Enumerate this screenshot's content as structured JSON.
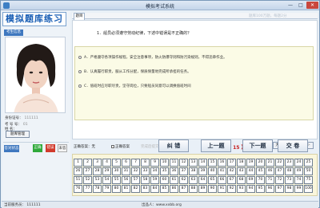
{
  "window": {
    "title": "模拟考试系统",
    "min": "—",
    "max": "□",
    "close": "✕"
  },
  "left": {
    "brand": "模拟题库练习",
    "photo_label": "考生信息",
    "id_card_label": "身份证号：",
    "id_card_value": "111111",
    "exam_no_label": "考 号 号：",
    "exam_no_value": "01",
    "name_label": "姓  名：",
    "name_value": "",
    "exam_manage_button": "题库管理",
    "status_label": "答对状态",
    "chip_correct": "正确",
    "chip_wrong": "错误",
    "chip_unanswered": "未答"
  },
  "tabs": {
    "active": "题目"
  },
  "watermark": "题库100万题，每题2分",
  "question": {
    "text": "1．船员必须遵守劳动纪律，下述中错误是不正确的？",
    "options": [
      "A．严格遵守各项操作规程，安全注意事项，防火防爆守则和防污染规则，不得违章作业。",
      "B．认真履行职责，服从工作分配，保质保量地完成所承担的任务。",
      "C．值班时应尽职尽责，坚守岗位，只要船员同意可以调换值班时间"
    ]
  },
  "answer": {
    "label": "正确答案：",
    "value": "无",
    "check_label": "正确答案",
    "hint": "完成后提交本题",
    "number_label": "题库编号：【 15 】",
    "font_big": "大字体+",
    "font_small": "小字体-"
  },
  "nav": {
    "correct": "纠 错",
    "prev": "上一题",
    "next": "下一题",
    "submit": "交 卷"
  },
  "grid": {
    "rows": [
      [
        "1",
        "2",
        "3",
        "4",
        "5",
        "6",
        "7",
        "8",
        "9",
        "10",
        "11",
        "12",
        "13",
        "14",
        "15",
        "16",
        "17",
        "18",
        "19",
        "20",
        "21",
        "22",
        "23",
        "24",
        "25"
      ],
      [
        "26",
        "27",
        "28",
        "29",
        "30",
        "31",
        "32",
        "33",
        "34",
        "35",
        "36",
        "37",
        "38",
        "39",
        "40",
        "41",
        "42",
        "43",
        "44",
        "45",
        "46",
        "47",
        "48",
        "49",
        "50"
      ],
      [
        "51",
        "52",
        "53",
        "54",
        "55",
        "56",
        "57",
        "58",
        "59",
        "60",
        "61",
        "62",
        "63",
        "64",
        "65",
        "66",
        "67",
        "68",
        "69",
        "70",
        "71",
        "72",
        "73",
        "74",
        "75"
      ],
      [
        "76",
        "77",
        "78",
        "79",
        "80",
        "81",
        "82",
        "83",
        "84",
        "85",
        "86",
        "87",
        "88",
        "89",
        "90",
        "91",
        "92",
        "93",
        "94",
        "95",
        "96",
        "97",
        "98",
        "99",
        "100"
      ]
    ]
  },
  "statusbar": {
    "left": "当前服务员：   111111",
    "center": "出品人：www.xxbb.org"
  }
}
